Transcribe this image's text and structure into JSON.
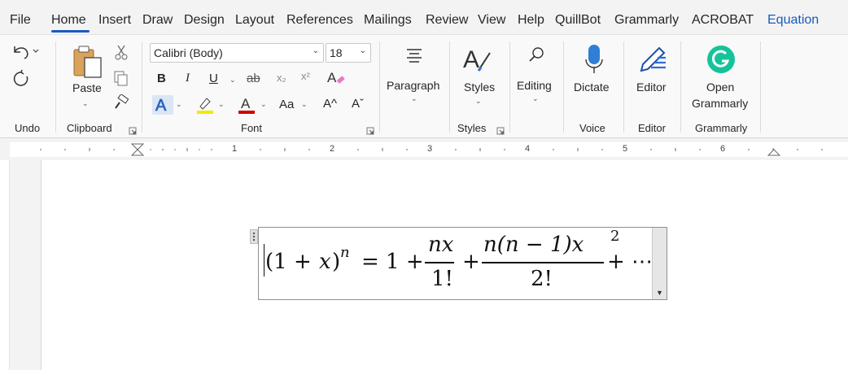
{
  "menu": {
    "tabs": [
      "File",
      "Home",
      "Insert",
      "Draw",
      "Design",
      "Layout",
      "References",
      "Mailings",
      "Review",
      "View",
      "Help",
      "QuillBot",
      "Grammarly",
      "ACROBAT",
      "Equation"
    ],
    "active_tab": "Home"
  },
  "ribbon": {
    "undo_group": "Undo",
    "clipboard": {
      "paste": "Paste",
      "group": "Clipboard"
    },
    "font": {
      "name": "Calibri (Body)",
      "size": "18",
      "bold": "B",
      "italic": "I",
      "underline": "U",
      "strike": "ab",
      "subscript": "x₂",
      "superscript": "x²",
      "change_case": "Aa",
      "grow": "A^",
      "shrink": "Aˇ",
      "text_effect": "A",
      "font_color": "A",
      "group": "Font"
    },
    "paragraph": {
      "label": "Paragraph"
    },
    "styles": {
      "label": "Styles",
      "group": "Styles"
    },
    "editing": {
      "label": "Editing"
    },
    "voice": {
      "label": "Dictate",
      "group": "Voice"
    },
    "editor": {
      "label": "Editor",
      "group": "Editor"
    },
    "grammarly": {
      "line1": "Open",
      "line2": "Grammarly",
      "group": "Grammarly"
    }
  },
  "ruler": {
    "numbers": [
      "1",
      "2",
      "3",
      "4",
      "5",
      "6"
    ]
  },
  "equation": {
    "lhs_open": "(1 + ",
    "lhs_x": "x",
    "lhs_close": ")",
    "lhs_exp": "n",
    "eq": "= 1 +",
    "frac1_num": "nx",
    "frac1_den": "1!",
    "plus": "+",
    "frac2_num": "n(n − 1)x",
    "frac2_num_exp": "2",
    "frac2_den": "2!",
    "tail": "+ ⋯"
  },
  "colors": {
    "accent": "#185abd",
    "highlight": "#f5e900",
    "font_red": "#d00000",
    "grammarly": "#15c39a"
  }
}
